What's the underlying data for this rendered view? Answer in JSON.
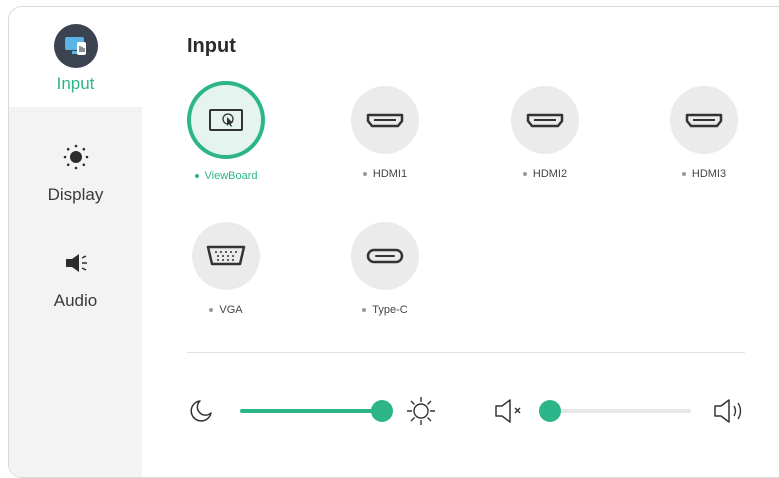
{
  "sidebar": {
    "items": [
      {
        "label": "Input",
        "icon": "input-icon",
        "active": true
      },
      {
        "label": "Display",
        "icon": "sun-icon",
        "active": false
      },
      {
        "label": "Audio",
        "icon": "speaker-icon",
        "active": false
      }
    ]
  },
  "main": {
    "title": "Input",
    "sources": [
      {
        "label": "ViewBoard",
        "icon": "viewboard-icon",
        "selected": true
      },
      {
        "label": "HDMI1",
        "icon": "hdmi-port-icon",
        "selected": false
      },
      {
        "label": "HDMI2",
        "icon": "hdmi-port-icon",
        "selected": false
      },
      {
        "label": "HDMI3",
        "icon": "hdmi-port-icon",
        "selected": false
      },
      {
        "label": "VGA",
        "icon": "vga-port-icon",
        "selected": false
      },
      {
        "label": "Type-C",
        "icon": "usb-c-port-icon",
        "selected": false
      }
    ]
  },
  "sliders": {
    "brightness": {
      "level": 1.0,
      "min_icon": "moon-icon",
      "max_icon": "sun-icon"
    },
    "volume": {
      "level": 0.0,
      "min_icon": "mute-icon",
      "max_icon": "speaker-loud-icon"
    }
  },
  "colors": {
    "accent": "#2db58a",
    "icon_dark": "#3c4350",
    "circle_bg": "#ebebeb",
    "sidebar_bg": "#f2f3f2"
  }
}
